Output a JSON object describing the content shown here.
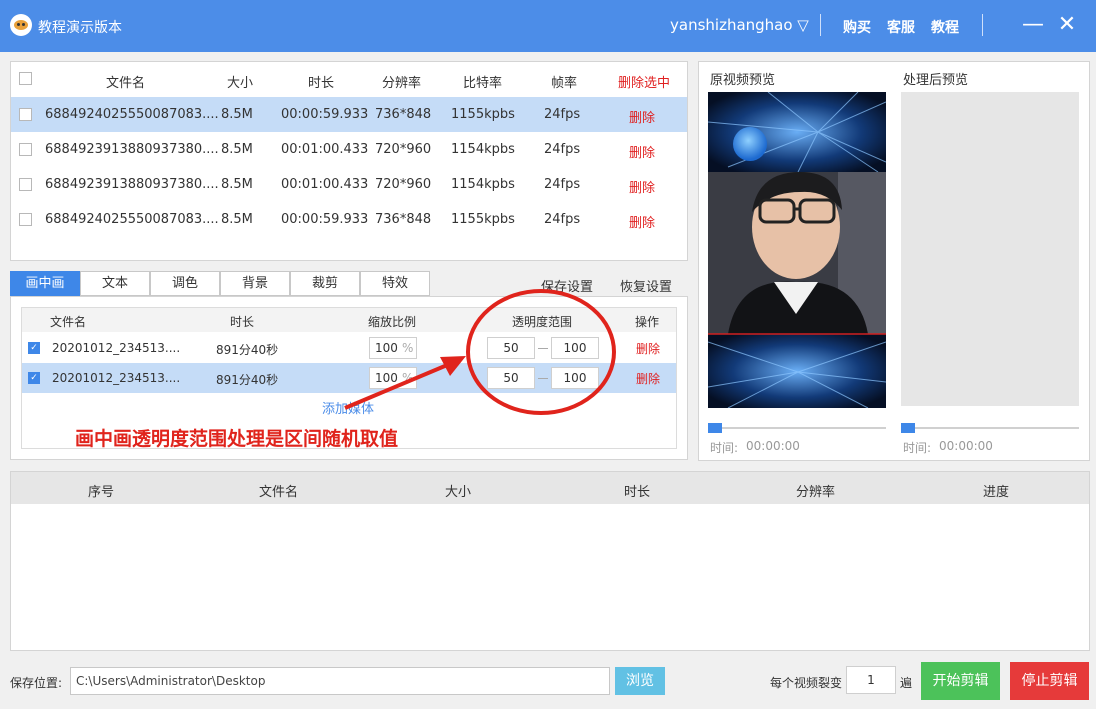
{
  "app": {
    "title": "教程演示版本",
    "username": "yanshizhanghao ▽",
    "links": [
      "购买",
      "客服",
      "教程"
    ],
    "minimize_icon": "—",
    "close_icon": "✕"
  },
  "file_table": {
    "headers": [
      "文件名",
      "大小",
      "时长",
      "分辨率",
      "比特率",
      "帧率",
      "删除选中"
    ],
    "rows": [
      {
        "name": "6884924025550087083....",
        "size": "8.5M",
        "duration": "00:00:59.933",
        "resolution": "736*848",
        "bitrate": "1155kpbs",
        "fps": "24fps",
        "action": "删除",
        "selected": true
      },
      {
        "name": "6884923913880937380....",
        "size": "8.5M",
        "duration": "00:01:00.433",
        "resolution": "720*960",
        "bitrate": "1154kpbs",
        "fps": "24fps",
        "action": "删除",
        "selected": false
      },
      {
        "name": "6884923913880937380....",
        "size": "8.5M",
        "duration": "00:01:00.433",
        "resolution": "720*960",
        "bitrate": "1154kpbs",
        "fps": "24fps",
        "action": "删除",
        "selected": false
      },
      {
        "name": "6884924025550087083....",
        "size": "8.5M",
        "duration": "00:00:59.933",
        "resolution": "736*848",
        "bitrate": "1155kpbs",
        "fps": "24fps",
        "action": "删除",
        "selected": false
      }
    ]
  },
  "tabs": [
    "画中画",
    "文本",
    "调色",
    "背景",
    "裁剪",
    "特效"
  ],
  "active_tab": 0,
  "tab_actions": {
    "save": "保存设置",
    "restore": "恢复设置"
  },
  "pip": {
    "headers": [
      "文件名",
      "时长",
      "缩放比例",
      "透明度范围",
      "操作"
    ],
    "rows": [
      {
        "name": "20201012_234513....",
        "duration": "891分40秒",
        "scale": "100",
        "scale_unit": "%",
        "opacity_min": "50",
        "opacity_max": "100",
        "action": "删除",
        "selected": false
      },
      {
        "name": "20201012_234513....",
        "duration": "891分40秒",
        "scale": "100",
        "scale_unit": "%",
        "opacity_min": "50",
        "opacity_max": "100",
        "action": "删除",
        "selected": true
      }
    ],
    "add_media": "添加媒体"
  },
  "annotation": "画中画透明度范围处理是区间随机取值",
  "preview": {
    "original_label": "原视频预览",
    "processed_label": "处理后预览",
    "time_label": "时间:",
    "original_time": "00:00:00",
    "processed_time": "00:00:00"
  },
  "queue": {
    "headers": [
      "序号",
      "文件名",
      "大小",
      "时长",
      "分辨率",
      "进度"
    ]
  },
  "bottom": {
    "save_label": "保存位置:",
    "save_path": "C:\\Users\\Administrator\\Desktop",
    "browse": "浏览",
    "split_label": "每个视频裂变",
    "split_count": "1",
    "split_unit": "遍",
    "start": "开始剪辑",
    "stop": "停止剪辑"
  },
  "colors": {
    "accent": "#4c8de8",
    "delete": "#e02020",
    "start": "#4cc25a",
    "stop": "#e63a3a",
    "annotation": "#e0241c"
  }
}
